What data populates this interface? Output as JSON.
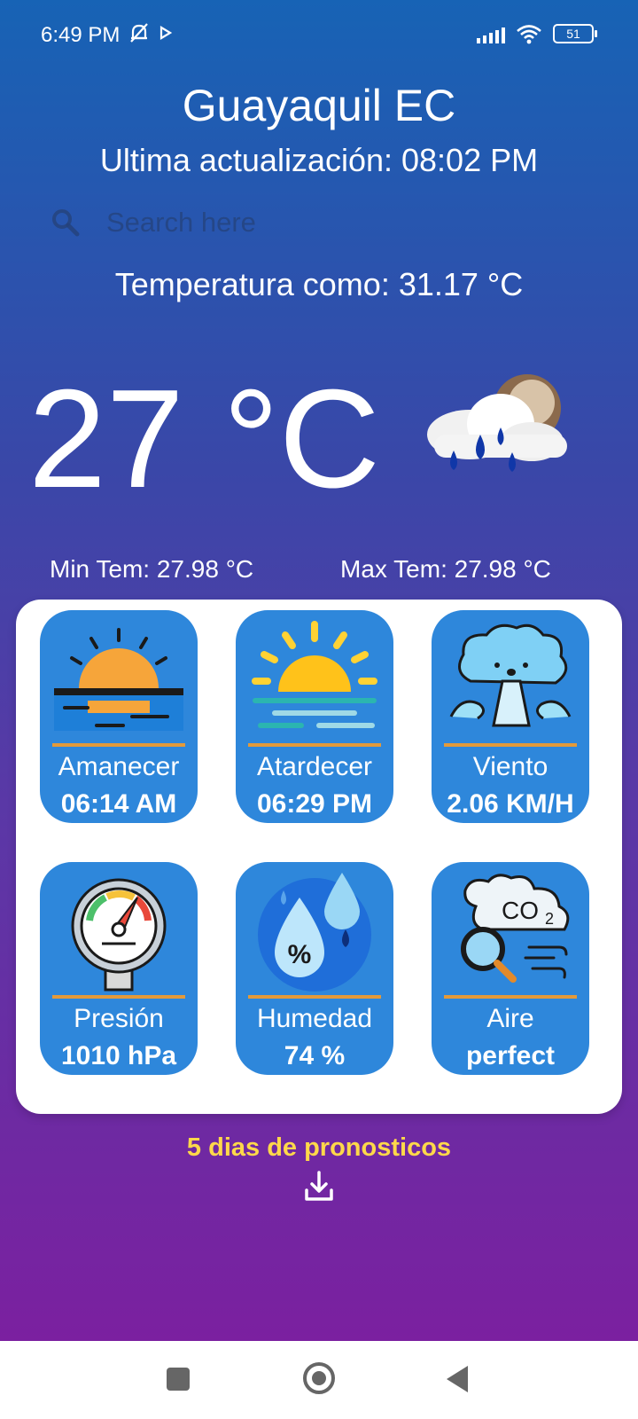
{
  "status_bar": {
    "time": "6:49 PM",
    "battery": "51"
  },
  "header": {
    "city": "Guayaquil EC",
    "updated": "Ultima actualización: 08:02 PM"
  },
  "search": {
    "placeholder": "Search here",
    "value": ""
  },
  "feels_like": "Temperatura como: 31.17 °C",
  "current_temp": "27 °C",
  "min_temp": "Min Tem: 27.98 °C",
  "max_temp": "Max Tem: 27.98 °C",
  "tiles": [
    {
      "label": "Amanecer",
      "value": "06:14 AM",
      "icon": "sunrise-icon"
    },
    {
      "label": "Atardecer",
      "value": "06:29 PM",
      "icon": "sunset-icon"
    },
    {
      "label": "Viento",
      "value": "2.06 KM/H",
      "icon": "wind-icon"
    },
    {
      "label": "Presión",
      "value": "1010 hPa",
      "icon": "pressure-gauge-icon"
    },
    {
      "label": "Humedad",
      "value": "74 %",
      "icon": "humidity-icon"
    },
    {
      "label": "Aire",
      "value": "perfect",
      "icon": "co2-air-icon"
    }
  ],
  "forecast_link": "5 dias de pronosticos",
  "colors": {
    "tile": "#2e87db",
    "accent_bar": "#e39a3a",
    "link": "#ffd84a"
  }
}
